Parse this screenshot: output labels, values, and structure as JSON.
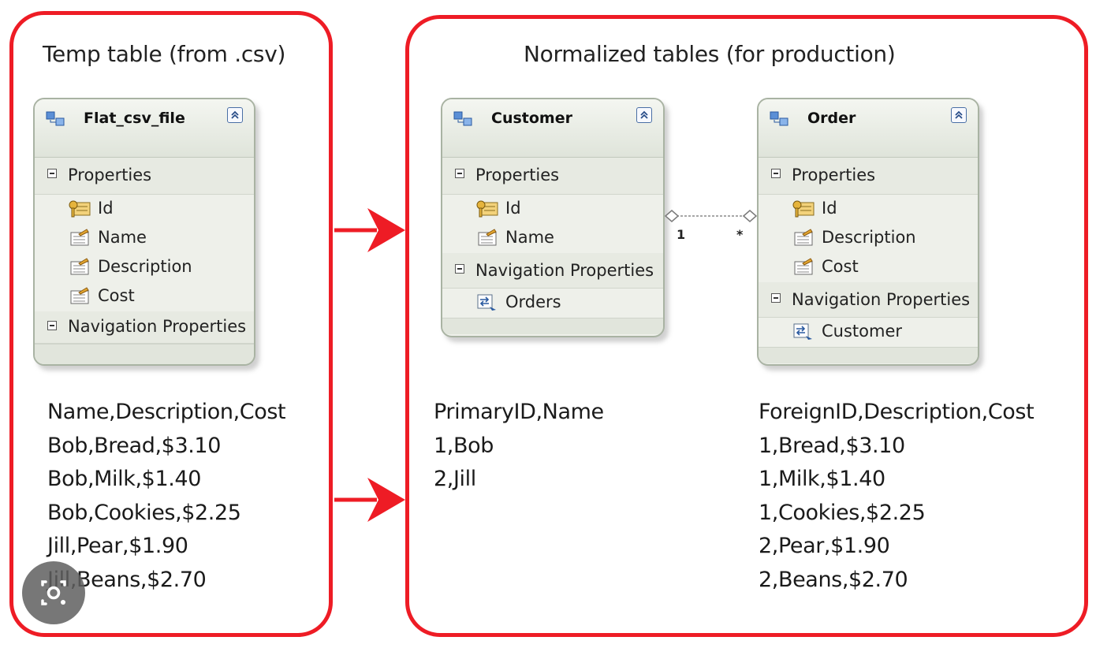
{
  "diagram": {
    "left_panel": {
      "heading": "Temp table (from .csv)",
      "entity": {
        "title": "Flat_csv_file",
        "properties_label": "Properties",
        "properties": [
          "Id",
          "Name",
          "Description",
          "Cost"
        ],
        "navigation_label": "Navigation Properties",
        "navigation": []
      },
      "csv_lines": [
        "Name,Description,Cost",
        "Bob,Bread,$3.10",
        "Bob,Milk,$1.40",
        "Bob,Cookies,$2.25",
        "Jill,Pear,$1.90",
        "Jill,Beans,$2.70"
      ]
    },
    "right_panel": {
      "heading": "Normalized tables (for production)",
      "customer": {
        "title": "Customer",
        "properties_label": "Properties",
        "properties": [
          "Id",
          "Name"
        ],
        "navigation_label": "Navigation Properties",
        "navigation": [
          "Orders"
        ]
      },
      "order": {
        "title": "Order",
        "properties_label": "Properties",
        "properties": [
          "Id",
          "Description",
          "Cost"
        ],
        "navigation_label": "Navigation Properties",
        "navigation": [
          "Customer"
        ]
      },
      "association": {
        "customer_end": "1",
        "order_end": "*"
      },
      "customer_csv_lines": [
        "PrimaryID,Name",
        "1,Bob",
        "2,Jill"
      ],
      "order_csv_lines": [
        "ForeignID,Description,Cost",
        "1,Bread,$3.10",
        "1,Milk,$1.40",
        "1,Cookies,$2.25",
        "2,Pear,$1.90",
        "2,Beans,$2.70"
      ]
    },
    "colors": {
      "frame": "#ee1c25",
      "arrow": "#ee1c25",
      "entity_border": "#a9b3a3"
    }
  }
}
